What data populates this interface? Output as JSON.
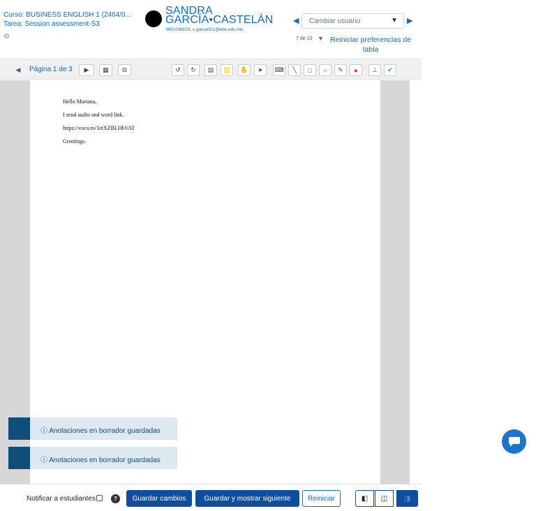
{
  "header": {
    "course": "Curso: BUSINESS ENGLISH 1 (2464/0...",
    "task": "Tarea: Session assessment-S3",
    "user_name_line1": "SANDRA",
    "user_name_line2": "GARCÍA•CASTELÁN",
    "user_id_email": "M01038153, s.garca001@ebc.edu.mx",
    "user_select_placeholder": "Cambiar usuario",
    "count": "7 de 10",
    "reset_prefs": "Reiniciar preferencias de tabla"
  },
  "toolbar": {
    "page_label": "Página 1 de 3"
  },
  "document": {
    "lines": [
      "Hello Mariana,",
      "I send audio and word link.",
      "https://voca.ro/1etXZBLHbVAT",
      "Greetings."
    ]
  },
  "toasts": [
    "Anotaciones en borrador guardadas",
    "Anotaciones en borrador guardadas"
  ],
  "footer": {
    "notify_label": "Notificar a estudiantes",
    "save_label": "Guardar cambios",
    "save_next_label": "Guardar y mostrar siguiente",
    "reset_label": "Reiniciar"
  },
  "colors": {
    "accent": "#0f6cbf",
    "primary_button": "#0f4e9e",
    "toast_bar": "#0f4e7a",
    "chat": "#1e73d1"
  }
}
